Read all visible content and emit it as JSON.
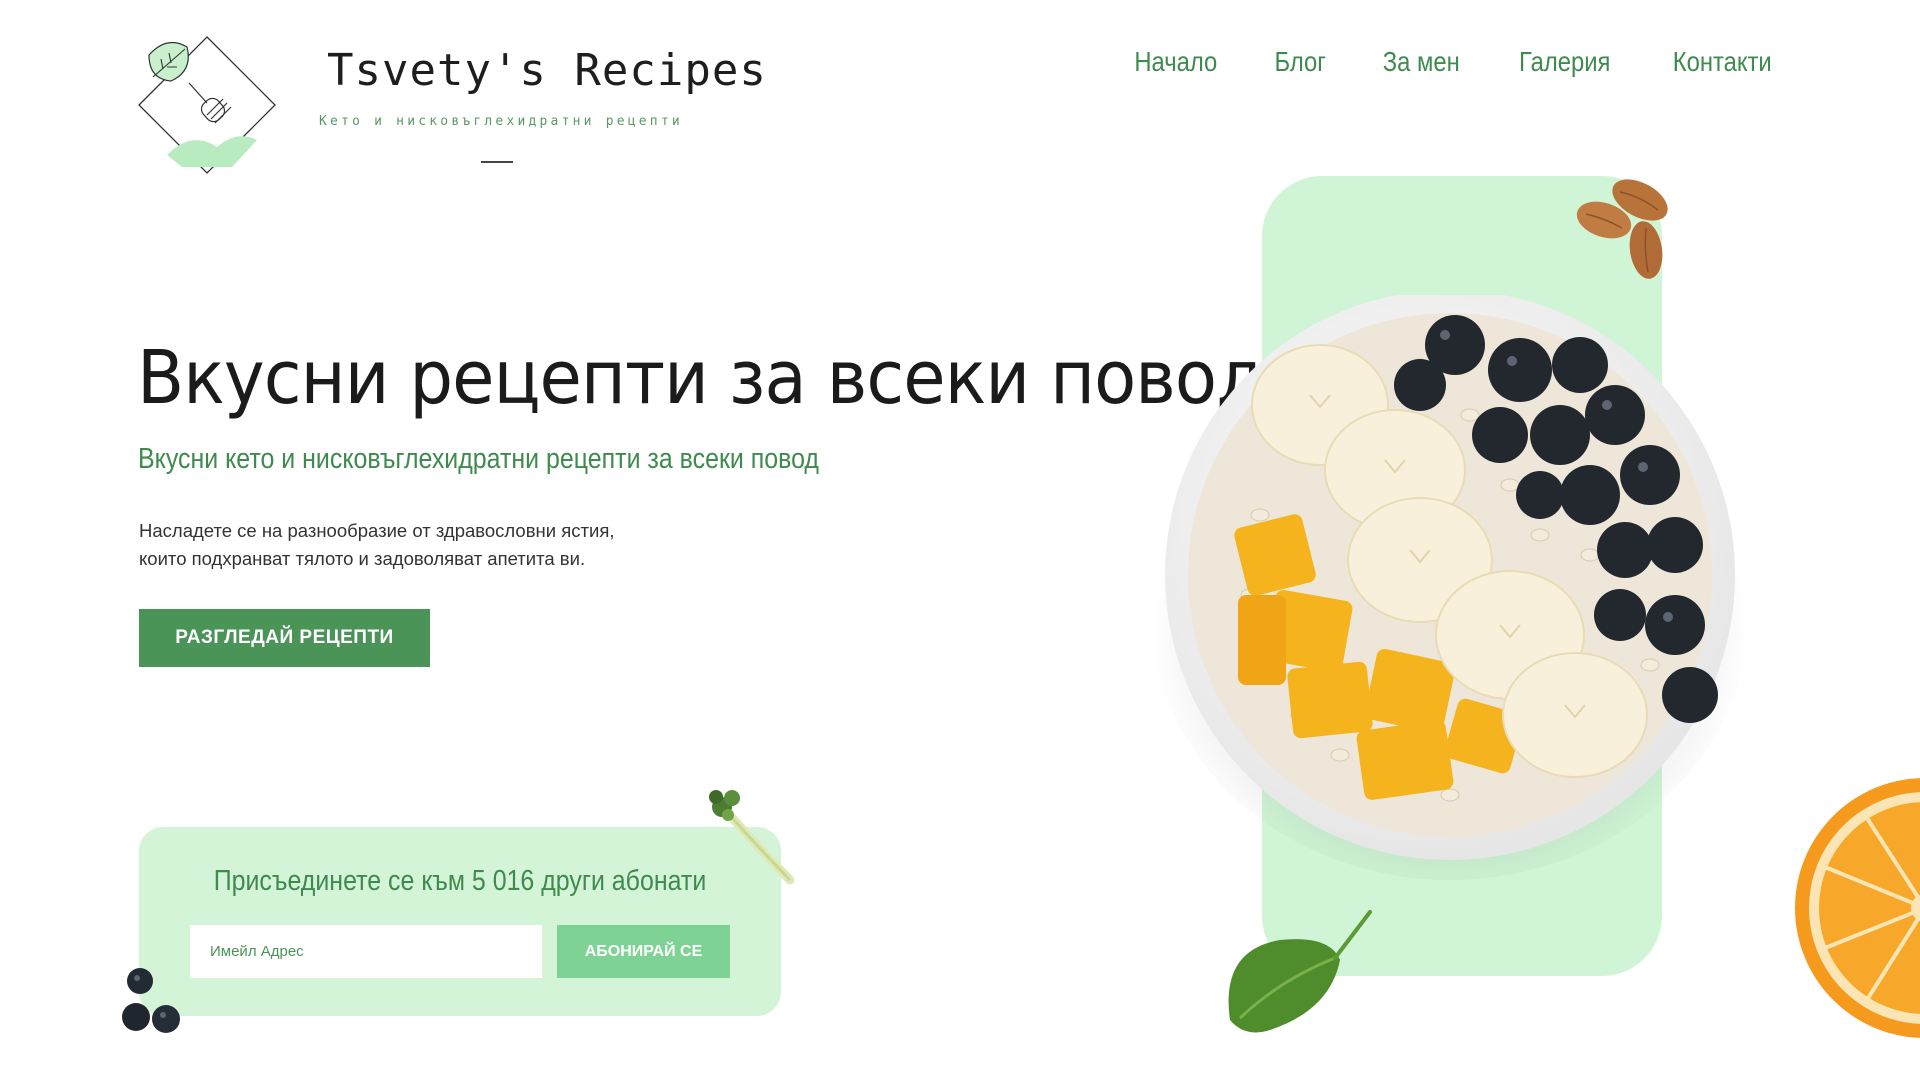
{
  "header": {
    "title": "Tsvety's Recipes",
    "tagline": "Кето и нисковъглехидратни рецепти",
    "nav": [
      "Начало",
      "Блог",
      "За мен",
      "Галерия",
      "Контакти"
    ]
  },
  "hero": {
    "title": "Вкусни рецепти за всеки повод",
    "subtitle": "Вкусни кето и нисковъглехидратни рецепти за всеки повод",
    "description": [
      "Насладете се на разнообразие от здравословни ястия,",
      "които подхранват тялото и задоволяват апетита ви."
    ],
    "cta_label": "РАЗГЛЕДАЙ РЕЦЕПТИ"
  },
  "subscribe": {
    "heading": "Присъединете се към 5 016 други абонати",
    "email_placeholder": "Имейл Адрес",
    "button_label": "АБОНИРАЙ СЕ"
  },
  "colors": {
    "accent": "#4a9458",
    "accent_text": "#3f8a4e",
    "panel": "#d0f5d6",
    "card": "#d4f4d8",
    "button_light": "#7ed394"
  },
  "icons": [
    "logo-leaf-fork-icon",
    "almonds-image",
    "fruit-bowl-image",
    "orange-image",
    "spinach-leaf-image",
    "broccoli-image",
    "blueberries-image"
  ]
}
